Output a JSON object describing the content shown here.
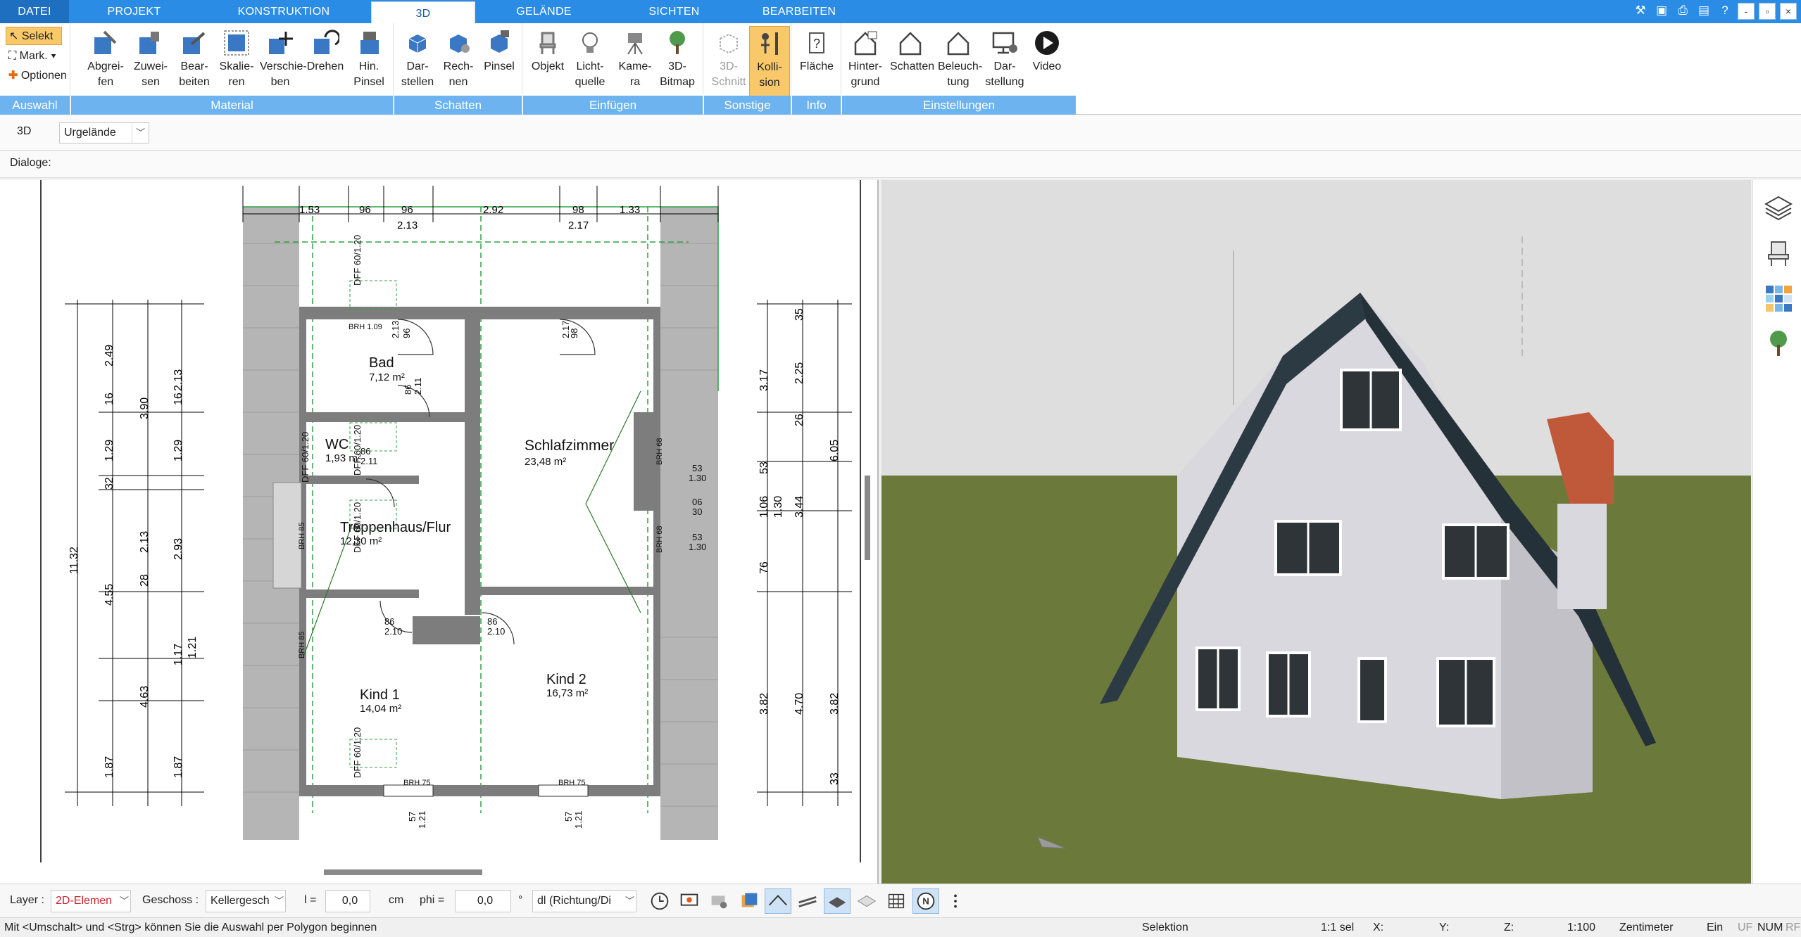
{
  "tabs": [
    {
      "label": "DATEI"
    },
    {
      "label": "PROJEKT"
    },
    {
      "label": "KONSTRUKTION"
    },
    {
      "label": "3D"
    },
    {
      "label": "GELÄNDE"
    },
    {
      "label": "SICHTEN"
    },
    {
      "label": "BEARBEITEN"
    }
  ],
  "window_buttons": {
    "minimize": "-",
    "restore": "▫",
    "close": "×",
    "sub_restore": "▫"
  },
  "ribbon": {
    "auswahl": {
      "label": "Auswahl",
      "select": "Selekt",
      "mark": "Mark.",
      "options": "Optionen"
    },
    "material": {
      "label": "Material",
      "buttons": [
        {
          "l1": "Abgrei-",
          "l2": "fen"
        },
        {
          "l1": "Zuwei-",
          "l2": "sen"
        },
        {
          "l1": "Bear-",
          "l2": "beiten"
        },
        {
          "l1": "Skalie-",
          "l2": "ren"
        },
        {
          "l1": "Verschie-",
          "l2": "ben"
        },
        {
          "l1": "Drehen",
          "l2": ""
        },
        {
          "l1": "Hin.",
          "l2": "Pinsel"
        }
      ]
    },
    "schatten": {
      "label": "Schatten",
      "buttons": [
        {
          "l1": "Dar-",
          "l2": "stellen"
        },
        {
          "l1": "Rech-",
          "l2": "nen"
        },
        {
          "l1": "Pinsel",
          "l2": ""
        }
      ]
    },
    "einfuegen": {
      "label": "Einfügen",
      "buttons": [
        {
          "l1": "Objekt",
          "l2": ""
        },
        {
          "l1": "Licht-",
          "l2": "quelle"
        },
        {
          "l1": "Kame-",
          "l2": "ra"
        },
        {
          "l1": "3D-",
          "l2": "Bitmap"
        }
      ]
    },
    "sonstige": {
      "label": "Sonstige",
      "buttons": [
        {
          "l1": "3D-",
          "l2": "Schnitt"
        },
        {
          "l1": "Kolli-",
          "l2": "sion"
        }
      ]
    },
    "info": {
      "label": "Info",
      "buttons": [
        {
          "l1": "Fläche",
          "l2": ""
        }
      ]
    },
    "einstellungen": {
      "label": "Einstellungen",
      "buttons": [
        {
          "l1": "Hinter-",
          "l2": "grund"
        },
        {
          "l1": "Schatten",
          "l2": ""
        },
        {
          "l1": "Beleuch-",
          "l2": "tung"
        },
        {
          "l1": "Dar-",
          "l2": "stellung"
        },
        {
          "l1": "Video",
          "l2": ""
        }
      ]
    }
  },
  "toolbar": {
    "mode": "3D",
    "terrain_select": "Urgelände",
    "dialogs_label": "Dialoge:"
  },
  "plan": {
    "rooms": [
      {
        "name": "Bad",
        "area": "7,12 m²"
      },
      {
        "name": "WC",
        "area": "1,93 m²"
      },
      {
        "name": "Schlafzimmer",
        "area": "23,48 m²"
      },
      {
        "name": "Treppenhaus/Flur",
        "area": "12,30 m²"
      },
      {
        "name": "Kind 1",
        "area": "14,04 m²"
      },
      {
        "name": "Kind 2",
        "area": "16,73 m²"
      }
    ],
    "top_dims": [
      "1.53",
      "96",
      "96",
      "2.92",
      "98",
      "1.33",
      "2.13",
      "2.17"
    ],
    "left_dims": [
      "11.32",
      "2.49",
      "3.90",
      "1.29",
      "2.13",
      "4.55",
      "1.17",
      "4.63",
      "1.87",
      "2.13",
      "1.29",
      "2.93",
      "1.21",
      "1.87",
      "32",
      "28",
      "16",
      "16"
    ],
    "right_dims": [
      "3.17",
      "2.25",
      "6.05",
      "1.06",
      "1.30",
      "3.44",
      "3.82",
      "4.70",
      "3.82",
      "53",
      "26",
      "76",
      "35",
      "33"
    ],
    "labels": {
      "dff1": "DFF 60/1.20",
      "dff2": "DFF 60/1.20",
      "dff3": "DFF 60/1.20",
      "dff4": "DFF 60/1.20",
      "dff5": "DFF 60/1.20",
      "brh109": "BRH 1.09",
      "brh85a": "BRH 85",
      "brh85b": "BRH 85",
      "brh75a": "BRH 75",
      "brh75b": "BRH 75",
      "brh68": "BRH 68",
      "brh68b": "BRH 68",
      "door1": "86",
      "door1b": "2.10",
      "door2": "86",
      "door2b": "2.10",
      "door3": "86",
      "door3b": "2.11",
      "door4": "86",
      "door4b": "2.11",
      "door5": "98",
      "door5b": "2.17",
      "door6": "96",
      "door6b": "2.13",
      "win_r1": "53",
      "win_r1b": "1.30",
      "win_r2": "06",
      "win_r2b": "30",
      "win_r3": "53",
      "win_r3b": "1.30",
      "bottom1": "57",
      "bottom1b": "1.21",
      "bottom2": "57",
      "bottom2b": "1.21"
    }
  },
  "bottombar": {
    "layer_label": "Layer :",
    "layer_value": "2D-Elemen",
    "geschoss_label": "Geschoss :",
    "geschoss_value": "Kellergesch",
    "l_label": "l =",
    "l_value": "0,0",
    "l_unit": "cm",
    "phi_label": "phi =",
    "phi_value": "0,0",
    "phi_unit": "°",
    "dl_value": "dl (Richtung/Di"
  },
  "status": {
    "hint": "Mit <Umschalt> und <Strg> können Sie die Auswahl per Polygon beginnen",
    "mode": "Selektion",
    "sel": "1:1 sel",
    "x": "X:",
    "y": "Y:",
    "z": "Z:",
    "scale": "1:100",
    "unit": "Zentimeter",
    "ein": "Ein",
    "uf": "UF",
    "num": "NUM",
    "rf": "RF"
  },
  "colors": {
    "tab_blue": "#2b8ce6",
    "group_label": "#6db3ef",
    "active_btn": "#f9c86a",
    "grass": "#6b7a3a",
    "roof": "#2c3a44",
    "roof_tile": "#c0583a"
  }
}
